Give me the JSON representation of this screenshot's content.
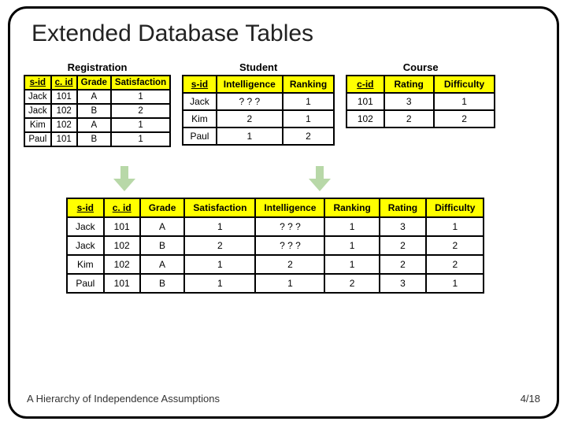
{
  "title": "Extended Database Tables",
  "registration": {
    "title": "Registration",
    "headers": [
      "s-id",
      "c. id",
      "Grade",
      "Satisfaction"
    ],
    "rows": [
      [
        "Jack",
        "101",
        "A",
        "1"
      ],
      [
        "Jack",
        "102",
        "B",
        "2"
      ],
      [
        "Kim",
        "102",
        "A",
        "1"
      ],
      [
        "Paul",
        "101",
        "B",
        "1"
      ]
    ]
  },
  "student": {
    "title": "Student",
    "headers": [
      "s-id",
      "Intelligence",
      "Ranking"
    ],
    "rows": [
      [
        "Jack",
        "? ? ?",
        "1"
      ],
      [
        "Kim",
        "2",
        "1"
      ],
      [
        "Paul",
        "1",
        "2"
      ]
    ]
  },
  "course": {
    "title": "Course",
    "headers": [
      "c-id",
      "Rating",
      "Difficulty"
    ],
    "rows": [
      [
        "101",
        "3",
        "1"
      ],
      [
        "102",
        "2",
        "2"
      ]
    ]
  },
  "joined": {
    "headers": [
      "s-id",
      "c. id",
      "Grade",
      "Satisfaction",
      "Intelligence",
      "Ranking",
      "Rating",
      "Difficulty"
    ],
    "rows": [
      [
        "Jack",
        "101",
        "A",
        "1",
        "? ? ?",
        "1",
        "3",
        "1"
      ],
      [
        "Jack",
        "102",
        "B",
        "2",
        "? ? ?",
        "1",
        "2",
        "2"
      ],
      [
        "Kim",
        "102",
        "A",
        "1",
        "2",
        "1",
        "2",
        "2"
      ],
      [
        "Paul",
        "101",
        "B",
        "1",
        "1",
        "2",
        "3",
        "1"
      ]
    ]
  },
  "footer_left": "A Hierarchy of Independence Assumptions",
  "footer_right": "4/18"
}
